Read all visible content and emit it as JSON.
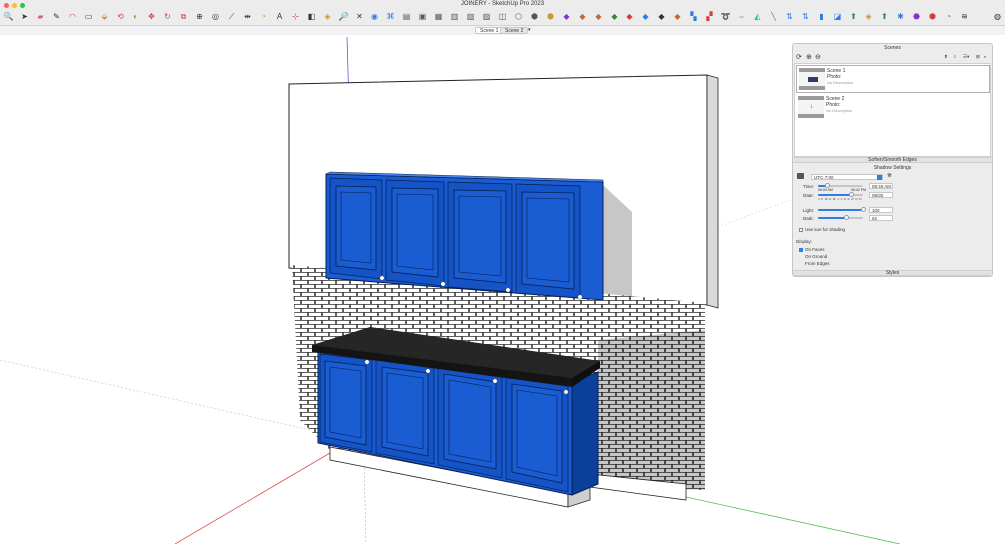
{
  "window": {
    "title": "JOINERY - SketchUp Pro 2023"
  },
  "traffic_lights": [
    "#ff5f57",
    "#febc2e",
    "#28c840"
  ],
  "toolbar": {
    "tools": [
      {
        "name": "zoom-icon",
        "glyph": "🔍",
        "color": "#333"
      },
      {
        "name": "select-icon",
        "glyph": "➤",
        "color": "#333"
      },
      {
        "name": "eraser-icon",
        "glyph": "▰",
        "color": "#d35a8a"
      },
      {
        "name": "line-icon",
        "glyph": "✎",
        "color": "#333"
      },
      {
        "name": "arc-icon",
        "glyph": "◠",
        "color": "#d63b3b"
      },
      {
        "name": "rectangle-icon",
        "glyph": "▭",
        "color": "#333"
      },
      {
        "name": "push-pull-icon",
        "glyph": "⬙",
        "color": "#c9962f"
      },
      {
        "name": "offset-icon",
        "glyph": "⟲",
        "color": "#d63b3b"
      },
      {
        "name": "paint-bucket-icon",
        "glyph": "◐",
        "color": "#8a9a2f"
      },
      {
        "name": "move-icon",
        "glyph": "✥",
        "color": "#d63b3b"
      },
      {
        "name": "rotate-icon",
        "glyph": "↻",
        "color": "#d63b3b"
      },
      {
        "name": "scale-icon",
        "glyph": "⧉",
        "color": "#d63b3b"
      },
      {
        "name": "follow-me-icon",
        "glyph": "⊕",
        "color": "#333"
      },
      {
        "name": "orbit-icon",
        "glyph": "◎",
        "color": "#333"
      },
      {
        "name": "tape-measure-icon",
        "glyph": "⟋",
        "color": "#333"
      },
      {
        "name": "dimension-icon",
        "glyph": "⇹",
        "color": "#333"
      },
      {
        "name": "protractor-icon",
        "glyph": "◔",
        "color": "#c9962f"
      },
      {
        "name": "text-icon",
        "glyph": "A",
        "color": "#333"
      },
      {
        "name": "axes-icon",
        "glyph": "⊹",
        "color": "#d63b3b"
      },
      {
        "name": "section-plane-icon",
        "glyph": "◧",
        "color": "#333"
      },
      {
        "name": "walk-icon",
        "glyph": "◈",
        "color": "#c9962f"
      },
      {
        "name": "zoom-window-icon",
        "glyph": "🔎",
        "color": "#333"
      },
      {
        "name": "zoom-extents-icon",
        "glyph": "✕",
        "color": "#333"
      },
      {
        "name": "previous-view-icon",
        "glyph": "◉",
        "color": "#2f7ce3"
      },
      {
        "name": "iso-view-icon",
        "glyph": "⌘",
        "color": "#2f7ce3"
      },
      {
        "name": "top-view-icon",
        "glyph": "▤",
        "color": "#555"
      },
      {
        "name": "front-view-icon",
        "glyph": "▣",
        "color": "#555"
      },
      {
        "name": "right-view-icon",
        "glyph": "▦",
        "color": "#555"
      },
      {
        "name": "back-view-icon",
        "glyph": "▥",
        "color": "#555"
      },
      {
        "name": "left-view-icon",
        "glyph": "▧",
        "color": "#555"
      },
      {
        "name": "bottom-view-icon",
        "glyph": "▨",
        "color": "#555"
      },
      {
        "name": "xray-icon",
        "glyph": "◫",
        "color": "#555"
      },
      {
        "name": "wireframe-icon",
        "glyph": "⬡",
        "color": "#555"
      },
      {
        "name": "hidden-line-icon",
        "glyph": "⬢",
        "color": "#555"
      },
      {
        "name": "shaded-icon",
        "glyph": "⬢",
        "color": "#c9962f"
      },
      {
        "name": "textured-icon",
        "glyph": "◆",
        "color": "#8a2fd6"
      },
      {
        "name": "monochrome-icon",
        "glyph": "◆",
        "color": "#c06a2f"
      },
      {
        "name": "outer-shell-icon",
        "glyph": "◆",
        "color": "#c06a2f"
      },
      {
        "name": "intersect-icon",
        "glyph": "◆",
        "color": "#2f8a3b"
      },
      {
        "name": "union-icon",
        "glyph": "◆",
        "color": "#d63b3b"
      },
      {
        "name": "subtract-icon",
        "glyph": "◆",
        "color": "#2f7ce3"
      },
      {
        "name": "trim-icon",
        "glyph": "◆",
        "color": "#333"
      },
      {
        "name": "split-icon",
        "glyph": "◆",
        "color": "#c06a2f"
      },
      {
        "name": "sandbox-contours-icon",
        "glyph": "▚",
        "color": "#2f7ce3"
      },
      {
        "name": "sandbox-scratch-icon",
        "glyph": "▞",
        "color": "#d63b3b"
      },
      {
        "name": "smoove-icon",
        "glyph": "➰",
        "color": "#d63b3b"
      },
      {
        "name": "stamp-icon",
        "glyph": "⌣",
        "color": "#2f7ce3"
      },
      {
        "name": "drape-icon",
        "glyph": "◭",
        "color": "#2fb0a5"
      },
      {
        "name": "add-detail-icon",
        "glyph": "╲",
        "color": "#2f7ce3"
      },
      {
        "name": "flip-edge-icon",
        "glyph": "⇅",
        "color": "#2f7ce3"
      },
      {
        "name": "warehouse-icon",
        "glyph": "⇅",
        "color": "#2f7ce3"
      },
      {
        "name": "share-model-icon",
        "glyph": "▮",
        "color": "#2f7ce3"
      },
      {
        "name": "extension-warehouse-icon",
        "glyph": "◪",
        "color": "#2f7ce3"
      },
      {
        "name": "extension-manager-icon",
        "glyph": "⬆",
        "color": "#2f8a3b"
      },
      {
        "name": "layout-icon",
        "glyph": "◈",
        "color": "#c9962f"
      },
      {
        "name": "style-builder-icon",
        "glyph": "⬆",
        "color": "#2f8a3b"
      },
      {
        "name": "trimble-connect-icon",
        "glyph": "✱",
        "color": "#2f7ce3"
      },
      {
        "name": "ruby-console-icon",
        "glyph": "⬣",
        "color": "#8a2fd6"
      },
      {
        "name": "solar-north-icon",
        "glyph": "⬢",
        "color": "#d63b3b"
      },
      {
        "name": "sync-icon",
        "glyph": "◔",
        "color": "#2f7ce3"
      },
      {
        "name": "curve-icon",
        "glyph": "≋",
        "color": "#333"
      }
    ],
    "right_tool": {
      "name": "search-sketchup-icon",
      "glyph": "◍",
      "color": "#333"
    }
  },
  "scene_tabs": [
    "Scene 1",
    "Scene 2"
  ],
  "scene_tabs_menu": "▾",
  "tray": {
    "scenes_title": "Scenes",
    "scenes": [
      {
        "name": "Scene 1",
        "photo": "Photo:",
        "desc": "No Description"
      },
      {
        "name": "Scene 2",
        "photo": "Photo:",
        "desc": "No Description"
      }
    ],
    "soften_title": "Soften/Smooth Edges",
    "shadow_title": "Shadow Settings",
    "utc": "UTC-7:00",
    "time_label": "Time:",
    "time_left": "06:00 AM",
    "time_right": "06:42 PM",
    "time_value": "08:40 AM",
    "time_fraction": 0.21,
    "date_label": "Date:",
    "months": "J F M A M J J A S O N D",
    "date_value": "09/30",
    "date_fraction": 0.74,
    "light_label": "Light:",
    "light_value": "100",
    "light_fraction": 1.0,
    "dark_label": "Dark:",
    "dark_value": "62",
    "dark_fraction": 0.62,
    "use_sun_label": "Use sun for shading",
    "display_label": "Display:",
    "on_faces_label": "On Faces",
    "on_ground_label": "On Ground",
    "from_edges_label": "From Edges",
    "styles_title": "Styles",
    "accent": "#2f7ce3"
  },
  "model": {
    "cabinet_blue": "#1a5cd2",
    "cabinet_dark": "#0b3f9a",
    "countertop": "#262626",
    "axis_red": "#e05050",
    "axis_green": "#5abf5a",
    "axis_blue": "#5a5ae0"
  }
}
